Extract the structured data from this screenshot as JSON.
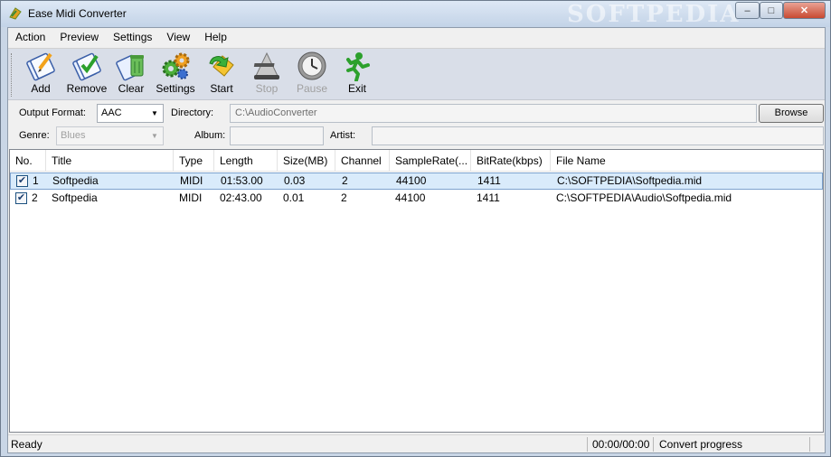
{
  "window": {
    "title": "Ease Midi Converter",
    "watermark": "SOFTPEDIA",
    "controls": {
      "minimize": "–",
      "maximize": "□",
      "close": "✕"
    }
  },
  "menu": [
    "Action",
    "Preview",
    "Settings",
    "View",
    "Help"
  ],
  "toolbar": [
    {
      "label": "Add",
      "icon": "add-icon",
      "enabled": true
    },
    {
      "label": "Remove",
      "icon": "remove-icon",
      "enabled": true
    },
    {
      "label": "Clear",
      "icon": "clear-icon",
      "enabled": true
    },
    {
      "label": "Settings",
      "icon": "settings-gears-icon",
      "enabled": true
    },
    {
      "label": "Start",
      "icon": "start-icon",
      "enabled": true
    },
    {
      "label": "Stop",
      "icon": "stop-icon",
      "enabled": false
    },
    {
      "label": "Pause",
      "icon": "pause-clock-icon",
      "enabled": false
    },
    {
      "label": "Exit",
      "icon": "exit-running-man-icon",
      "enabled": true
    }
  ],
  "options": {
    "output_format_label": "Output Format:",
    "output_format_value": "AAC",
    "directory_label": "Directory:",
    "directory_value": "C:\\AudioConverter",
    "browse_label": "Browse",
    "genre_label": "Genre:",
    "genre_value": "Blues",
    "album_label": "Album:",
    "album_value": "",
    "artist_label": "Artist:",
    "artist_value": ""
  },
  "table": {
    "columns": [
      "No.",
      "Title",
      "Type",
      "Length",
      "Size(MB)",
      "Channel",
      "SampleRate(...",
      "BitRate(kbps)",
      "File Name"
    ],
    "rows": [
      {
        "checked": true,
        "no": "1",
        "title": "Softpedia",
        "type": "MIDI",
        "length": "01:53.00",
        "size": "0.03",
        "channel": "2",
        "samplerate": "44100",
        "bitrate": "1411",
        "filename": "C:\\SOFTPEDIA\\Softpedia.mid"
      },
      {
        "checked": true,
        "no": "2",
        "title": "Softpedia",
        "type": "MIDI",
        "length": "02:43.00",
        "size": "0.01",
        "channel": "2",
        "samplerate": "44100",
        "bitrate": "1411",
        "filename": "C:\\SOFTPEDIA\\Audio\\Softpedia.mid"
      }
    ]
  },
  "status": {
    "state": "Ready",
    "time": "00:00/00:00",
    "progress_label": "Convert progress"
  },
  "colors": {
    "selection": "#d9ebfb",
    "toolbar_bg": "#d9dee8",
    "exit_green": "#2ca02c"
  }
}
